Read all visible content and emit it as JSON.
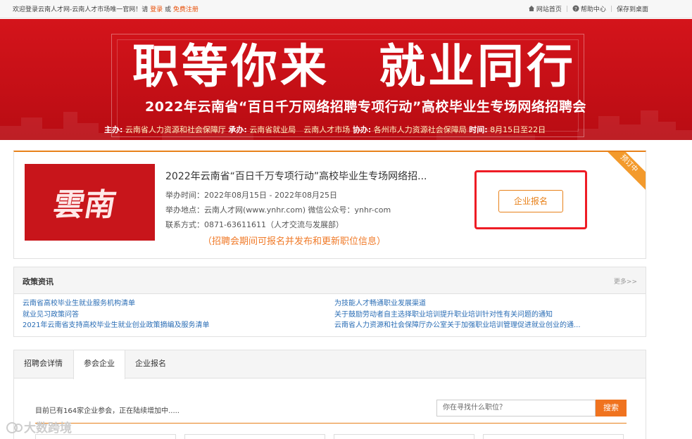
{
  "topbar": {
    "welcome_prefix": "欢迎登录云南人才网-云南人才市场唯一官网！请",
    "login": "登录",
    "or": "或",
    "register": "免费注册",
    "home": "网站首页",
    "help": "帮助中心",
    "save": "保存到桌面"
  },
  "banner": {
    "headline": "职等你来　就业同行",
    "subtitle": "2022年云南省“百日千万网络招聘专项行动”高校毕业生专场网络招聘会",
    "organizers": {
      "host_label": "主办:",
      "host": "云南省人力资源和社会保障厅",
      "undertake_label": "承办:",
      "undertake": "云南省就业局　云南人才市场",
      "assist_label": "协办:",
      "assist": "各州市人力资源社会保障局",
      "time_label": "时间:",
      "time": "8月15日至22日"
    }
  },
  "fair": {
    "thumb_text": "雲南",
    "title": "2022年云南省“百日千万专项行动”高校毕业生专场网络招...",
    "time": "举办时间：2022年08月15日 - 2022年08月25日",
    "place": "举办地点：云南人才网(www.ynhr.com) 微信公众号：ynhr-com",
    "contact": "联系方式：0871-63611611（人才交流与发展部）",
    "notice": "（招聘会期间可报名并发布和更新职位信息）",
    "apply_button": "企业报名",
    "status_ribbon": "预订中"
  },
  "policy": {
    "title": "政策资讯",
    "more": "更多>>",
    "left": [
      "云南省高校毕业生就业服务机构清单",
      "就业见习政策问答",
      "2021年云南省支持高校毕业生就业创业政策摘编及服务清单"
    ],
    "right": [
      "为技能人才畅通职业发展渠道",
      "关于鼓励劳动者自主选择职业培训提升职业培训针对性有关问题的通知",
      "云南省人力资源和社会保障厅办公室关于加强职业培训管理促进就业创业的通..."
    ]
  },
  "tabs": {
    "items": [
      "招聘会详情",
      "参会企业",
      "企业报名"
    ],
    "active": "参会企业",
    "count_text": "目前已有164家企业参会，正在陆续增加中.....",
    "search_placeholder": "你在寻找什么职位？",
    "search_button": "搜索"
  },
  "watermark": "大数跨境",
  "colors": {
    "accent": "#e8811a",
    "banner_red": "#c40f16",
    "link_blue": "#2a6db5",
    "highlight_red": "#ee1c25"
  }
}
